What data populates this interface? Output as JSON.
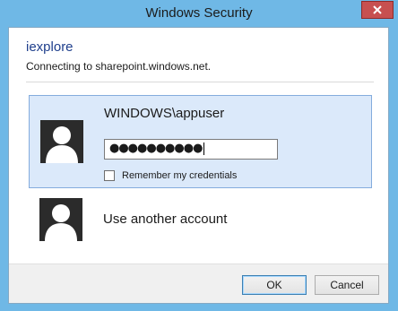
{
  "window": {
    "title": "Windows Security"
  },
  "header": {
    "app_name": "iexplore",
    "message": "Connecting to sharepoint.windows.net."
  },
  "selected_account": {
    "username": "WINDOWS\\appuser",
    "password_masked": "●●●●●●●●●●",
    "remember_label": "Remember my credentials",
    "remember_checked": false
  },
  "other_account": {
    "label": "Use another account"
  },
  "footer": {
    "ok_label": "OK",
    "cancel_label": "Cancel"
  },
  "colors": {
    "frame": "#6fb8e6",
    "close_button": "#c75050",
    "selected_bg": "#dbe9fa",
    "selected_border": "#84acdd",
    "app_name": "#1f3f8c"
  },
  "icons": {
    "close": "close-icon",
    "avatar": "user-avatar-icon"
  }
}
